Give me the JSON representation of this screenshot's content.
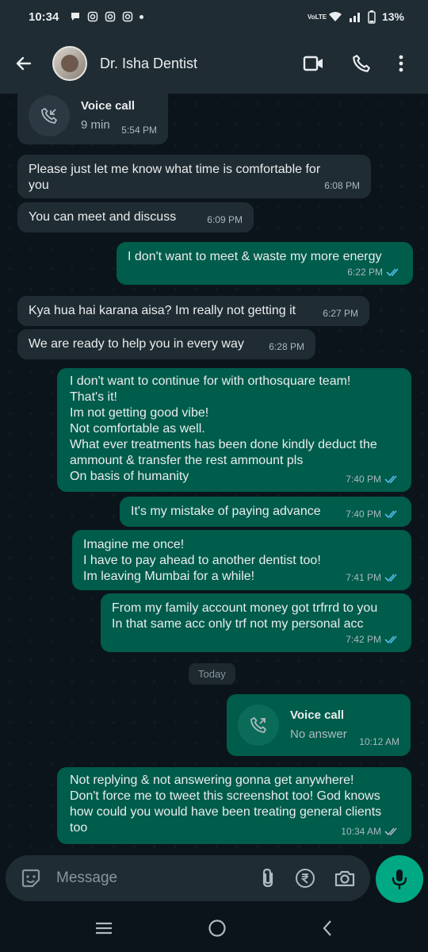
{
  "status_bar": {
    "time": "10:34",
    "network": "VoLTE",
    "battery": "13%"
  },
  "header": {
    "contact_name": "Dr. Isha Dentist"
  },
  "messages": [
    {
      "call_title": "Voice call",
      "call_sub": "9 min",
      "time": "5:54 PM"
    },
    {
      "text": "Please just let me know what time is comfortable for you",
      "time": "6:08 PM"
    },
    {
      "text": "You can meet and discuss",
      "time": "6:09 PM"
    },
    {
      "text": "I don't want to meet &  waste my more energy",
      "time": "6:22 PM"
    },
    {
      "text": "Kya hua hai karana aisa? Im really not getting it",
      "time": "6:27 PM"
    },
    {
      "text": "We are ready to help you in every way",
      "time": "6:28 PM"
    },
    {
      "text": "I don't want to continue for with orthosquare team!\nThat's it!\nIm not getting good vibe!\nNot comfortable as well.\nWhat ever treatments has been done kindly deduct the ammount & transfer the rest ammount pls\nOn basis of humanity",
      "time": "7:40 PM"
    },
    {
      "text": "It's my mistake of paying advance",
      "time": "7:40 PM"
    },
    {
      "text": "Imagine me once!\nI have to pay ahead to another dentist too!\nIm leaving Mumbai for a while!",
      "time": "7:41 PM"
    },
    {
      "text": "From my family account money got trfrrd to you\nIn that same acc only trf not my personal acc",
      "time": "7:42 PM"
    },
    {
      "call_title": "Voice call",
      "call_sub": "No answer",
      "time": "10:12 AM"
    },
    {
      "text": "Not replying & not answering gonna get anywhere!\nDon't force me to tweet this screenshot too! God knows how could you would have been treating general clients too",
      "time": "10:34 AM"
    }
  ],
  "day_separator": "Today",
  "input": {
    "placeholder": "Message"
  },
  "colors": {
    "header": "#1f2c34",
    "incoming": "#202c33",
    "outgoing": "#005c4b",
    "read_tick": "#53bdeb",
    "mic": "#00a884"
  }
}
